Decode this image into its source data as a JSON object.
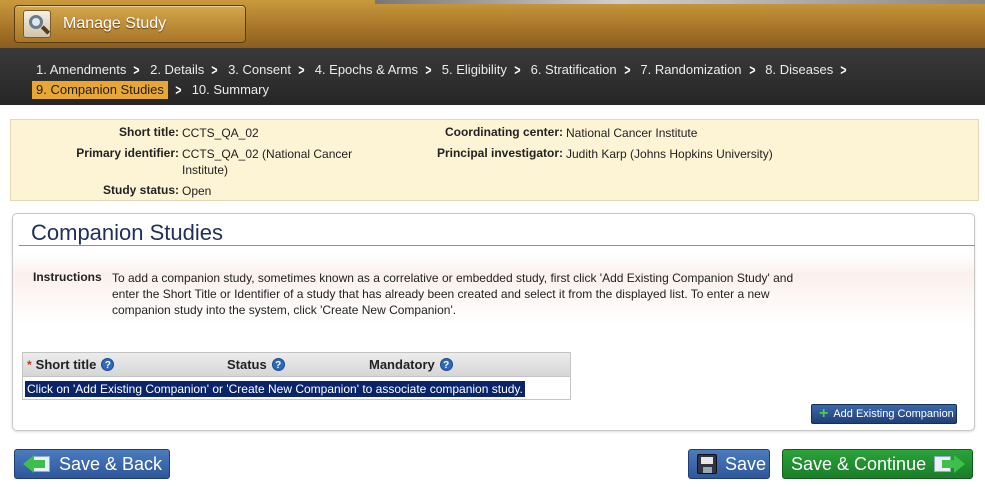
{
  "header": {
    "title": "Manage Study",
    "icon": "magnifier-icon"
  },
  "breadcrumb": {
    "row1": [
      {
        "label": "1. Amendments"
      },
      {
        "label": "2. Details"
      },
      {
        "label": "3. Consent"
      },
      {
        "label": "4. Epochs & Arms"
      },
      {
        "label": "5. Eligibility"
      },
      {
        "label": "6. Stratification"
      },
      {
        "label": "7. Randomization"
      },
      {
        "label": "8. Diseases"
      }
    ],
    "row2": [
      {
        "label": "9. Companion Studies",
        "active": true
      },
      {
        "label": "10. Summary"
      }
    ]
  },
  "study": {
    "short_title_label": "Short title:",
    "short_title": "CCTS_QA_02",
    "primary_id_label": "Primary identifier:",
    "primary_id": "CCTS_QA_02 (National Cancer Institute)",
    "status_label": "Study status:",
    "status": "Open",
    "coord_center_label": "Coordinating center:",
    "coord_center": "National Cancer Institute",
    "pi_label": "Principal investigator:",
    "pi": "Judith Karp (Johns Hopkins University)"
  },
  "companion": {
    "title": "Companion Studies",
    "instructions_label": "Instructions",
    "instructions": "To add a companion study, sometimes known as a correlative or embedded study, first click 'Add Existing Companion Study' and enter the Short Title or Identifier of a study that has already been created and select it from the displayed list. To enter a new companion study into the system, click 'Create New Companion'.",
    "columns": {
      "required_mark": "*",
      "short_title": "Short title",
      "status": "Status",
      "mandatory": "Mandatory",
      "help": "?"
    },
    "empty_message": "Click on 'Add Existing Companion' or 'Create New Companion' to associate companion study.",
    "add_button": "Add Existing Companion",
    "add_icon": "+"
  },
  "footer": {
    "back_label": "Save & Back",
    "save_label": "Save",
    "continue_label": "Save & Continue"
  },
  "colors": {
    "header_gold": "#a9772a",
    "active_crumb": "#e8a734",
    "summary_bg": "#fdf3d5",
    "button_blue": "#2d579a",
    "button_green": "#1b7d28",
    "selection_navy": "#0a246a"
  }
}
